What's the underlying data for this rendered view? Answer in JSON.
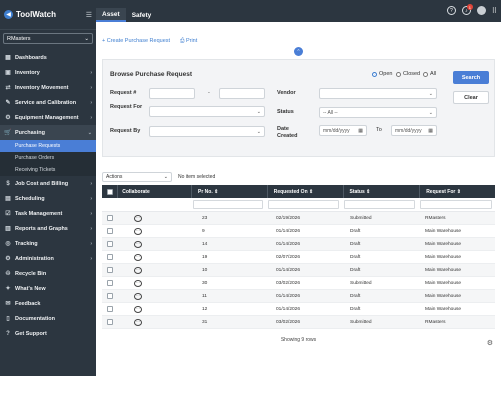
{
  "app": {
    "name": "ToolWatch"
  },
  "sidebar": {
    "tenant": "RMasters",
    "items": [
      {
        "label": "Dashboards",
        "icon": "dashboard-icon",
        "glyph": "▦",
        "chevron": ""
      },
      {
        "label": "Inventory",
        "icon": "inventory-icon",
        "glyph": "▣",
        "chevron": "›"
      },
      {
        "label": "Inventory Movement",
        "icon": "movement-icon",
        "glyph": "⇄",
        "chevron": "›"
      },
      {
        "label": "Service and Calibration",
        "icon": "service-icon",
        "glyph": "✎",
        "chevron": "›"
      },
      {
        "label": "Equipment Management",
        "icon": "equipment-icon",
        "glyph": "⚙",
        "chevron": "›"
      },
      {
        "label": "Purchasing",
        "icon": "purchasing-icon",
        "glyph": "🛒",
        "chevron": "⌄"
      }
    ],
    "sub_items": [
      {
        "label": "Purchase Requests",
        "active": true
      },
      {
        "label": "Purchase Orders",
        "active": false
      },
      {
        "label": "Receiving Tickets",
        "active": false
      }
    ],
    "items_after": [
      {
        "label": "Job Cost and Billing",
        "icon": "billing-icon",
        "glyph": "$",
        "chevron": "›"
      },
      {
        "label": "Scheduling",
        "icon": "calendar-icon",
        "glyph": "▤",
        "chevron": "›"
      },
      {
        "label": "Task Management",
        "icon": "tasks-icon",
        "glyph": "☑",
        "chevron": "›"
      },
      {
        "label": "Reports and Graphs",
        "icon": "reports-icon",
        "glyph": "▥",
        "chevron": "›"
      },
      {
        "label": "Tracking",
        "icon": "tracking-icon",
        "glyph": "◎",
        "chevron": "›"
      },
      {
        "label": "Administration",
        "icon": "admin-icon",
        "glyph": "⚙",
        "chevron": "›"
      },
      {
        "label": "Recycle Bin",
        "icon": "recycle-icon",
        "glyph": "♲",
        "chevron": ""
      },
      {
        "label": "What's New",
        "icon": "megaphone-icon",
        "glyph": "✦",
        "chevron": ""
      },
      {
        "label": "Feedback",
        "icon": "feedback-icon",
        "glyph": "✉",
        "chevron": ""
      },
      {
        "label": "Documentation",
        "icon": "doc-icon",
        "glyph": "▯",
        "chevron": ""
      },
      {
        "label": "Get Support",
        "icon": "support-icon",
        "glyph": "?",
        "chevron": ""
      }
    ]
  },
  "topbar": {
    "tabs": [
      {
        "label": "Asset",
        "active": true
      },
      {
        "label": "Safety",
        "active": false
      }
    ],
    "notification_count": "1"
  },
  "actions": {
    "create_label": "+ Create Purchase Request",
    "print_label": "⎙ Print"
  },
  "filter": {
    "title": "Browse Purchase Request",
    "labels": {
      "request_no": "Request #",
      "request_for": "Request For",
      "request_by": "Request By",
      "vendor": "Vendor",
      "status": "Status",
      "date_created": "Date Created",
      "range_sep": "-",
      "to": "To"
    },
    "status_value": "-- All --",
    "date_placeholder": "mm/dd/yyyy",
    "radios": [
      {
        "label": "Open",
        "checked": true
      },
      {
        "label": "Closed",
        "checked": false
      },
      {
        "label": "All",
        "checked": false
      }
    ],
    "search_label": "Search",
    "clear_label": "Clear"
  },
  "bulk": {
    "actions_label": "Actions",
    "selection_text": "No item selected"
  },
  "table": {
    "headers": {
      "collaborate": "Collaborate",
      "pr_no": "Pr No. ⇕",
      "requested_on": "Requested On ⇕",
      "status": "Status ⇕",
      "request_for": "Request For ⇕"
    },
    "rows": [
      {
        "pr": "23",
        "date": "02/19/2026",
        "status": "Submitted",
        "for": "RMasters"
      },
      {
        "pr": "9",
        "date": "01/14/2026",
        "status": "Draft",
        "for": "Main Warehouse"
      },
      {
        "pr": "14",
        "date": "01/14/2026",
        "status": "Draft",
        "for": "Main Warehouse"
      },
      {
        "pr": "19",
        "date": "02/07/2026",
        "status": "Draft",
        "for": "Main Warehouse"
      },
      {
        "pr": "10",
        "date": "01/14/2026",
        "status": "Draft",
        "for": "Main Warehouse"
      },
      {
        "pr": "30",
        "date": "03/02/2026",
        "status": "Submitted",
        "for": "Main Warehouse"
      },
      {
        "pr": "11",
        "date": "01/14/2026",
        "status": "Draft",
        "for": "Main Warehouse"
      },
      {
        "pr": "12",
        "date": "01/14/2026",
        "status": "Draft",
        "for": "Main Warehouse"
      },
      {
        "pr": "31",
        "date": "03/02/2026",
        "status": "Submitted",
        "for": "RMasters"
      }
    ],
    "footer": "Showing 9 rows"
  }
}
